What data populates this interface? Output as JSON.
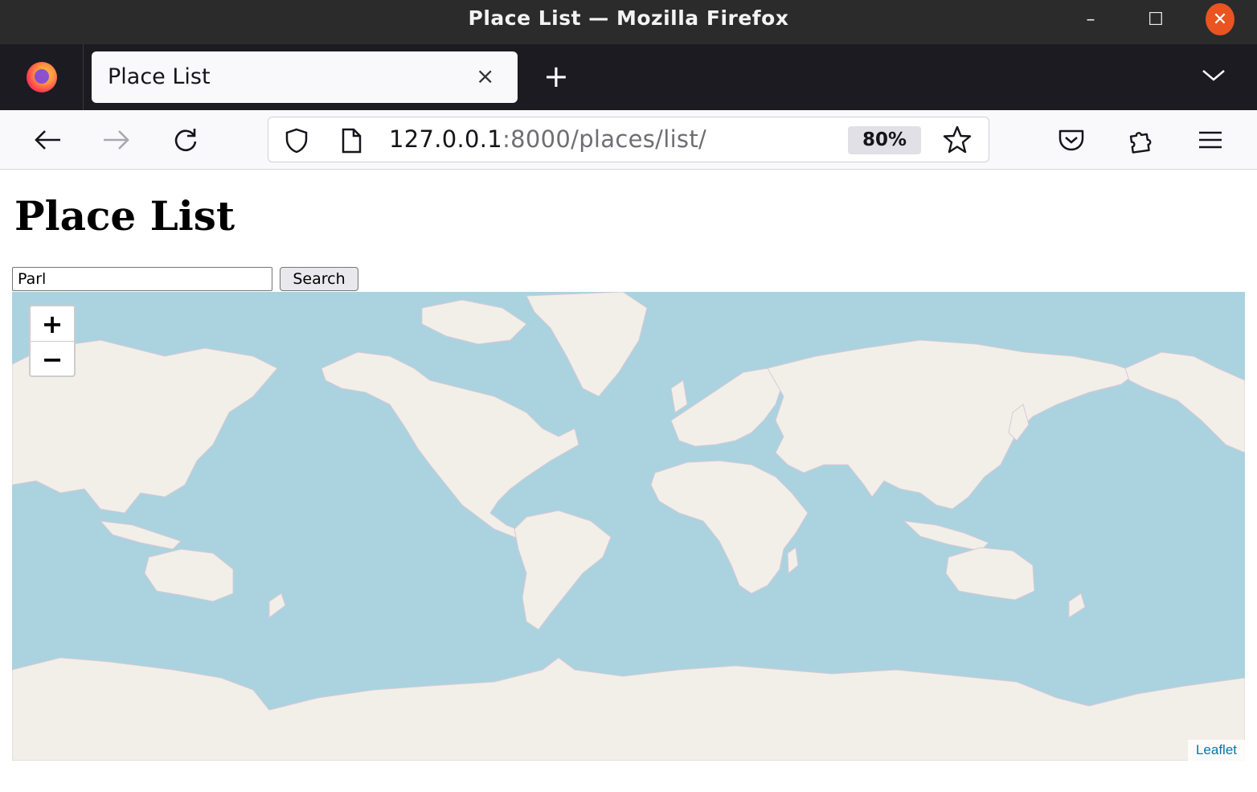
{
  "window": {
    "title": "Place List — Mozilla Firefox",
    "minimize_label": "–",
    "maximize_label": "☐",
    "close_label": "✕"
  },
  "tabs": {
    "active_title": "Place List",
    "close_label": "×",
    "new_tab_label": "+",
    "list_all_label": "﹀"
  },
  "navbar": {
    "back_label": "←",
    "forward_label": "→",
    "reload_label": "↻",
    "url_host": "127.0.0.1",
    "url_rest": ":8000/places/list/",
    "zoom": "80%"
  },
  "page": {
    "heading": "Place List",
    "search_value": "Parl",
    "search_button": "Search"
  },
  "map": {
    "zoom_in": "+",
    "zoom_out": "−",
    "attribution": "Leaflet",
    "ocean_color": "#aad3df",
    "land_color": "#f2efe9",
    "border_color": "#c9b3c9"
  }
}
